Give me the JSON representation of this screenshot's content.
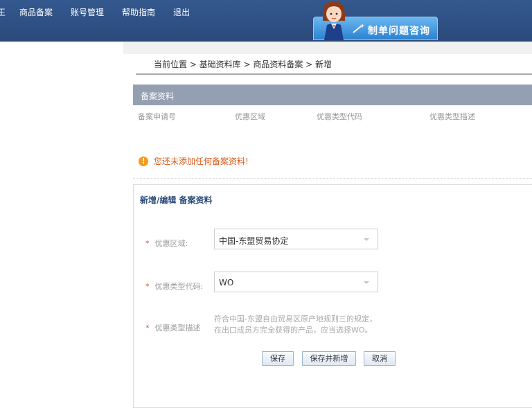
{
  "topnav": {
    "items": [
      "王",
      "商品备案",
      "账号管理",
      "帮助指南",
      "退出"
    ]
  },
  "help_button": {
    "label": "制单问题咨询"
  },
  "breadcrumb": "当前位置 > 基础资料库 > 商品资料备案 > 新增",
  "record_section": {
    "title": "备案资料",
    "columns": [
      "备案申请号",
      "优惠区域",
      "优惠类型代码",
      "优惠类型描述"
    ],
    "empty_message": "您还未添加任何备案资料!"
  },
  "edit_form": {
    "title": "新增/编辑 备案资料",
    "fields": {
      "zone": {
        "label": "优惠区域:",
        "value": "中国-东盟贸易协定"
      },
      "type_code": {
        "label": "优惠类型代码:",
        "value": "WO"
      },
      "type_desc": {
        "label": "优惠类型描述",
        "value": "符合中国-东盟自由贸易区原产地规则三的规定，在出口成员方完全获得的产品，应当选择WO。"
      }
    },
    "required_mark": "*",
    "buttons": {
      "save": "保存",
      "save_new": "保存并新增",
      "cancel": "取消"
    }
  },
  "colors": {
    "topbar": "#2f4f82",
    "section_header": "#94a0b1",
    "warning": "#f39c1f",
    "required": "#e74c3c"
  },
  "icons": {
    "warning": "warning-circle-icon",
    "agent": "customer-service-agent-icon"
  }
}
